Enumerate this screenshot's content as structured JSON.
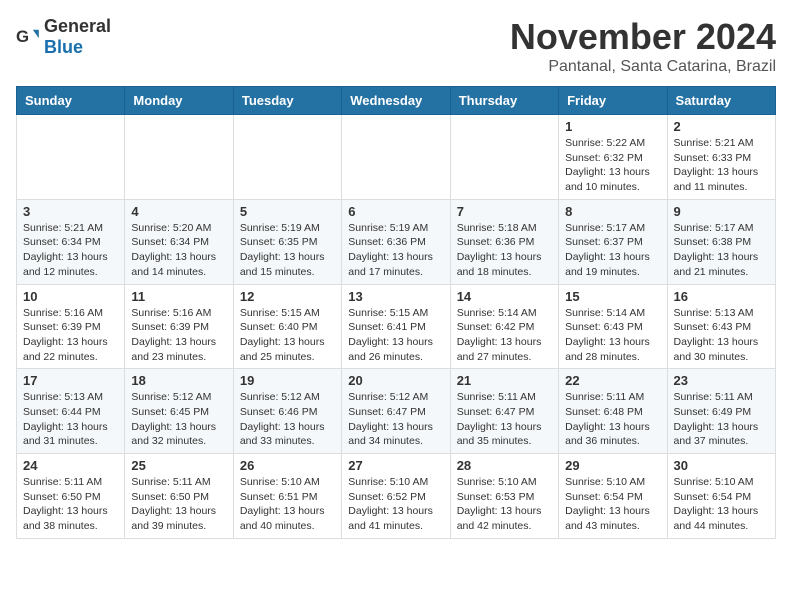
{
  "header": {
    "logo_general": "General",
    "logo_blue": "Blue",
    "month_title": "November 2024",
    "location": "Pantanal, Santa Catarina, Brazil"
  },
  "weekdays": [
    "Sunday",
    "Monday",
    "Tuesday",
    "Wednesday",
    "Thursday",
    "Friday",
    "Saturday"
  ],
  "weeks": [
    [
      {
        "day": "",
        "info": ""
      },
      {
        "day": "",
        "info": ""
      },
      {
        "day": "",
        "info": ""
      },
      {
        "day": "",
        "info": ""
      },
      {
        "day": "",
        "info": ""
      },
      {
        "day": "1",
        "info": "Sunrise: 5:22 AM\nSunset: 6:32 PM\nDaylight: 13 hours and 10 minutes."
      },
      {
        "day": "2",
        "info": "Sunrise: 5:21 AM\nSunset: 6:33 PM\nDaylight: 13 hours and 11 minutes."
      }
    ],
    [
      {
        "day": "3",
        "info": "Sunrise: 5:21 AM\nSunset: 6:34 PM\nDaylight: 13 hours and 12 minutes."
      },
      {
        "day": "4",
        "info": "Sunrise: 5:20 AM\nSunset: 6:34 PM\nDaylight: 13 hours and 14 minutes."
      },
      {
        "day": "5",
        "info": "Sunrise: 5:19 AM\nSunset: 6:35 PM\nDaylight: 13 hours and 15 minutes."
      },
      {
        "day": "6",
        "info": "Sunrise: 5:19 AM\nSunset: 6:36 PM\nDaylight: 13 hours and 17 minutes."
      },
      {
        "day": "7",
        "info": "Sunrise: 5:18 AM\nSunset: 6:36 PM\nDaylight: 13 hours and 18 minutes."
      },
      {
        "day": "8",
        "info": "Sunrise: 5:17 AM\nSunset: 6:37 PM\nDaylight: 13 hours and 19 minutes."
      },
      {
        "day": "9",
        "info": "Sunrise: 5:17 AM\nSunset: 6:38 PM\nDaylight: 13 hours and 21 minutes."
      }
    ],
    [
      {
        "day": "10",
        "info": "Sunrise: 5:16 AM\nSunset: 6:39 PM\nDaylight: 13 hours and 22 minutes."
      },
      {
        "day": "11",
        "info": "Sunrise: 5:16 AM\nSunset: 6:39 PM\nDaylight: 13 hours and 23 minutes."
      },
      {
        "day": "12",
        "info": "Sunrise: 5:15 AM\nSunset: 6:40 PM\nDaylight: 13 hours and 25 minutes."
      },
      {
        "day": "13",
        "info": "Sunrise: 5:15 AM\nSunset: 6:41 PM\nDaylight: 13 hours and 26 minutes."
      },
      {
        "day": "14",
        "info": "Sunrise: 5:14 AM\nSunset: 6:42 PM\nDaylight: 13 hours and 27 minutes."
      },
      {
        "day": "15",
        "info": "Sunrise: 5:14 AM\nSunset: 6:43 PM\nDaylight: 13 hours and 28 minutes."
      },
      {
        "day": "16",
        "info": "Sunrise: 5:13 AM\nSunset: 6:43 PM\nDaylight: 13 hours and 30 minutes."
      }
    ],
    [
      {
        "day": "17",
        "info": "Sunrise: 5:13 AM\nSunset: 6:44 PM\nDaylight: 13 hours and 31 minutes."
      },
      {
        "day": "18",
        "info": "Sunrise: 5:12 AM\nSunset: 6:45 PM\nDaylight: 13 hours and 32 minutes."
      },
      {
        "day": "19",
        "info": "Sunrise: 5:12 AM\nSunset: 6:46 PM\nDaylight: 13 hours and 33 minutes."
      },
      {
        "day": "20",
        "info": "Sunrise: 5:12 AM\nSunset: 6:47 PM\nDaylight: 13 hours and 34 minutes."
      },
      {
        "day": "21",
        "info": "Sunrise: 5:11 AM\nSunset: 6:47 PM\nDaylight: 13 hours and 35 minutes."
      },
      {
        "day": "22",
        "info": "Sunrise: 5:11 AM\nSunset: 6:48 PM\nDaylight: 13 hours and 36 minutes."
      },
      {
        "day": "23",
        "info": "Sunrise: 5:11 AM\nSunset: 6:49 PM\nDaylight: 13 hours and 37 minutes."
      }
    ],
    [
      {
        "day": "24",
        "info": "Sunrise: 5:11 AM\nSunset: 6:50 PM\nDaylight: 13 hours and 38 minutes."
      },
      {
        "day": "25",
        "info": "Sunrise: 5:11 AM\nSunset: 6:50 PM\nDaylight: 13 hours and 39 minutes."
      },
      {
        "day": "26",
        "info": "Sunrise: 5:10 AM\nSunset: 6:51 PM\nDaylight: 13 hours and 40 minutes."
      },
      {
        "day": "27",
        "info": "Sunrise: 5:10 AM\nSunset: 6:52 PM\nDaylight: 13 hours and 41 minutes."
      },
      {
        "day": "28",
        "info": "Sunrise: 5:10 AM\nSunset: 6:53 PM\nDaylight: 13 hours and 42 minutes."
      },
      {
        "day": "29",
        "info": "Sunrise: 5:10 AM\nSunset: 6:54 PM\nDaylight: 13 hours and 43 minutes."
      },
      {
        "day": "30",
        "info": "Sunrise: 5:10 AM\nSunset: 6:54 PM\nDaylight: 13 hours and 44 minutes."
      }
    ]
  ]
}
